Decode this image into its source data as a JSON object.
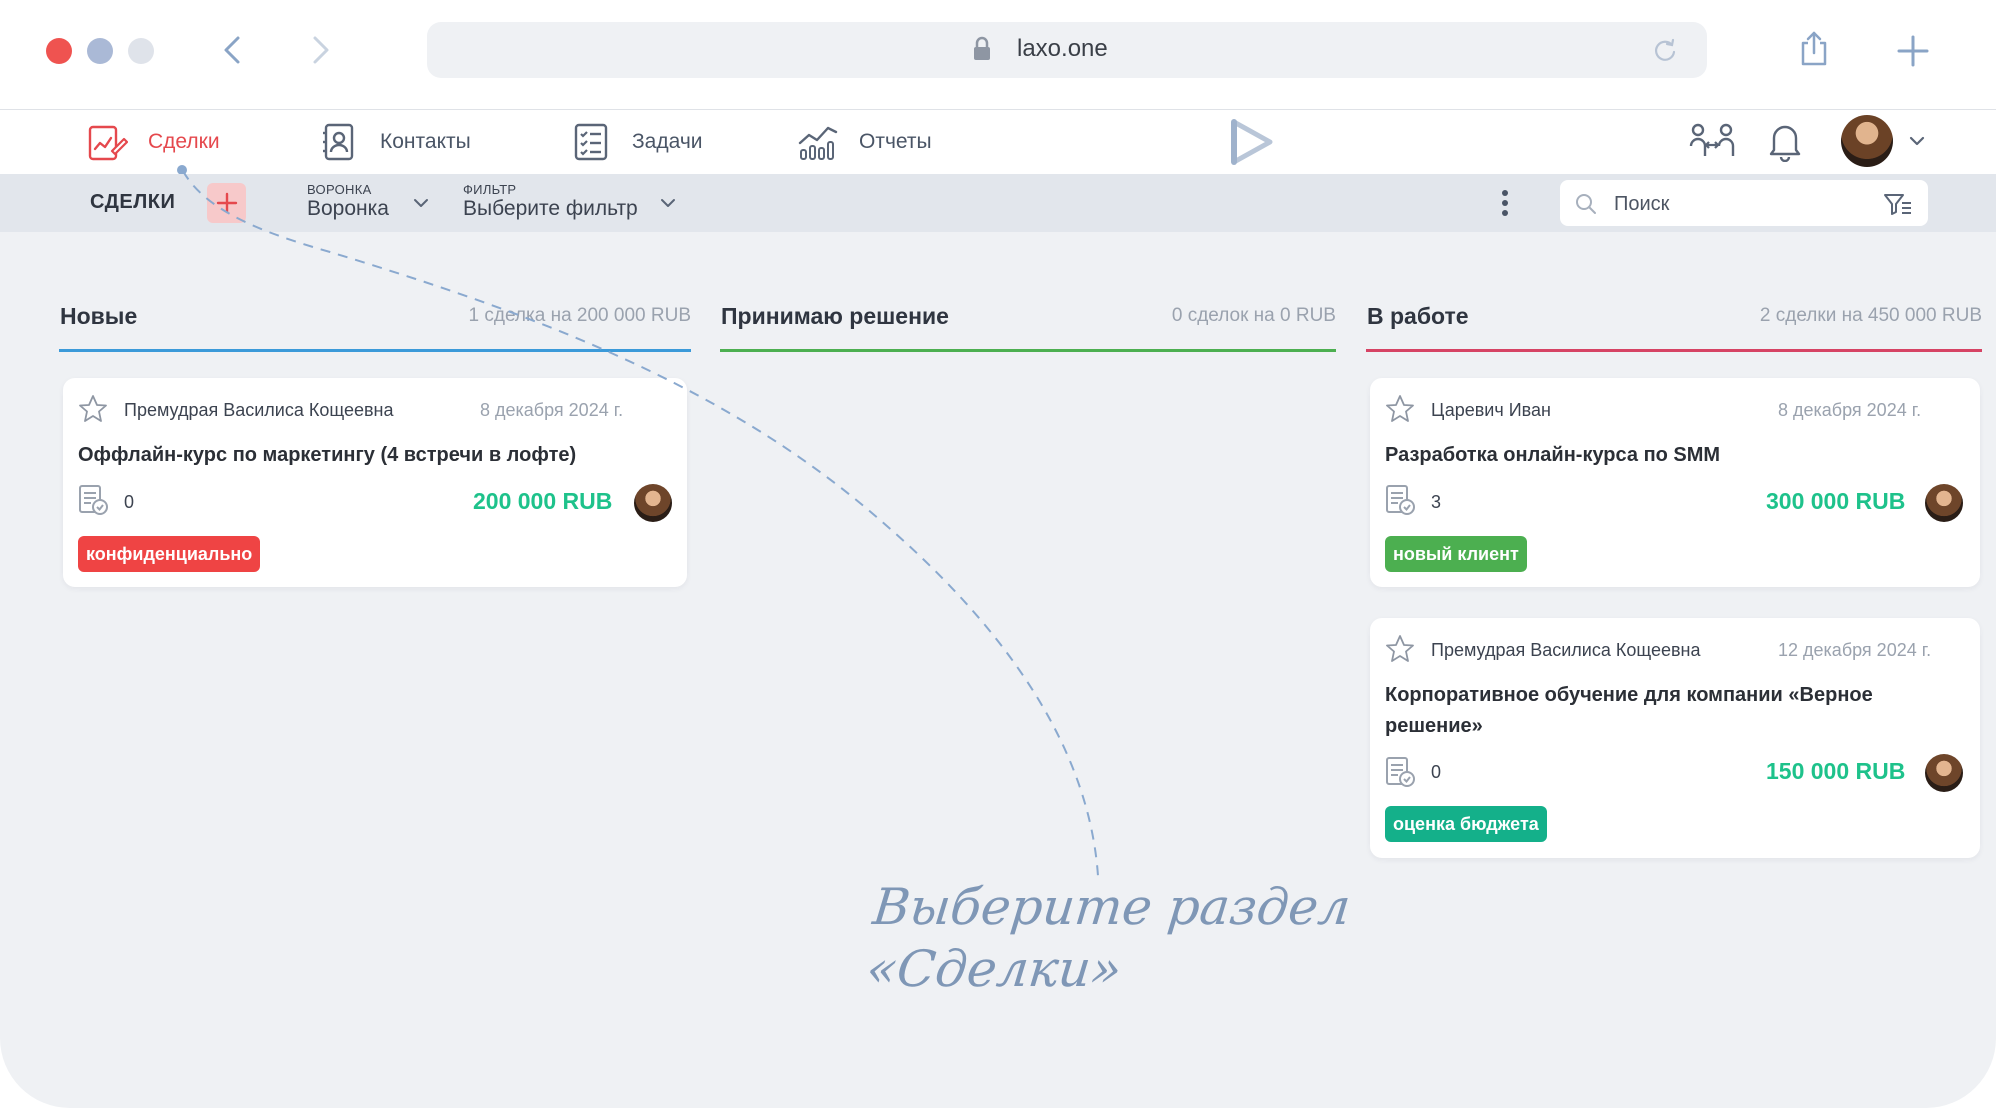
{
  "browser": {
    "url": "laxo.one"
  },
  "nav": {
    "items": [
      {
        "label": "Сделки",
        "icon": "deals-icon",
        "active": true
      },
      {
        "label": "Контакты",
        "icon": "contacts-icon",
        "active": false
      },
      {
        "label": "Задачи",
        "icon": "tasks-icon",
        "active": false
      },
      {
        "label": "Отчеты",
        "icon": "reports-icon",
        "active": false
      }
    ]
  },
  "toolbar": {
    "title": "СДЕЛКИ",
    "pipeline": {
      "label": "ВОРОНКА",
      "value": "Воронка"
    },
    "filter": {
      "label": "ФИЛЬТР",
      "value": "Выберите фильтр"
    },
    "search_placeholder": "Поиск"
  },
  "columns": [
    {
      "title": "Новые",
      "summary": "1 сделка на 200 000 RUB",
      "color": "#3b9ad9"
    },
    {
      "title": "Принимаю решение",
      "summary": "0 сделок на 0 RUB",
      "color": "#4caf50"
    },
    {
      "title": "В работе",
      "summary": "2 сделки на 450 000 RUB",
      "color": "#d64364"
    }
  ],
  "cards": [
    {
      "client": "Премудрая Василиса Кощеевна",
      "date": "8 декабря 2024 г.",
      "title": "Оффлайн-курс по маркетингу (4 встречи в лофте)",
      "count": "0",
      "amount": "200 000 RUB",
      "tag": "конфиденциально",
      "tag_color": "#ef4444"
    },
    {
      "client": "Царевич Иван",
      "date": "8 декабря 2024 г.",
      "title": "Разработка онлайн-курса по SMM",
      "count": "3",
      "amount": "300 000 RUB",
      "tag": "новый клиент",
      "tag_color": "#4caf50"
    },
    {
      "client": "Премудрая Василиса Кощеевна",
      "date": "12 декабря 2024 г.",
      "title": "Корпоративное обучение для компании «Верное решение»",
      "count": "0",
      "amount": "150 000 RUB",
      "tag": "оценка бюджета",
      "tag_color": "#14b08a"
    }
  ],
  "annotation": {
    "line1": "Выберите раздел",
    "line2": "«Сделки»"
  },
  "colors": {
    "accent": "#e5484d",
    "amount": "#1ec28b"
  }
}
